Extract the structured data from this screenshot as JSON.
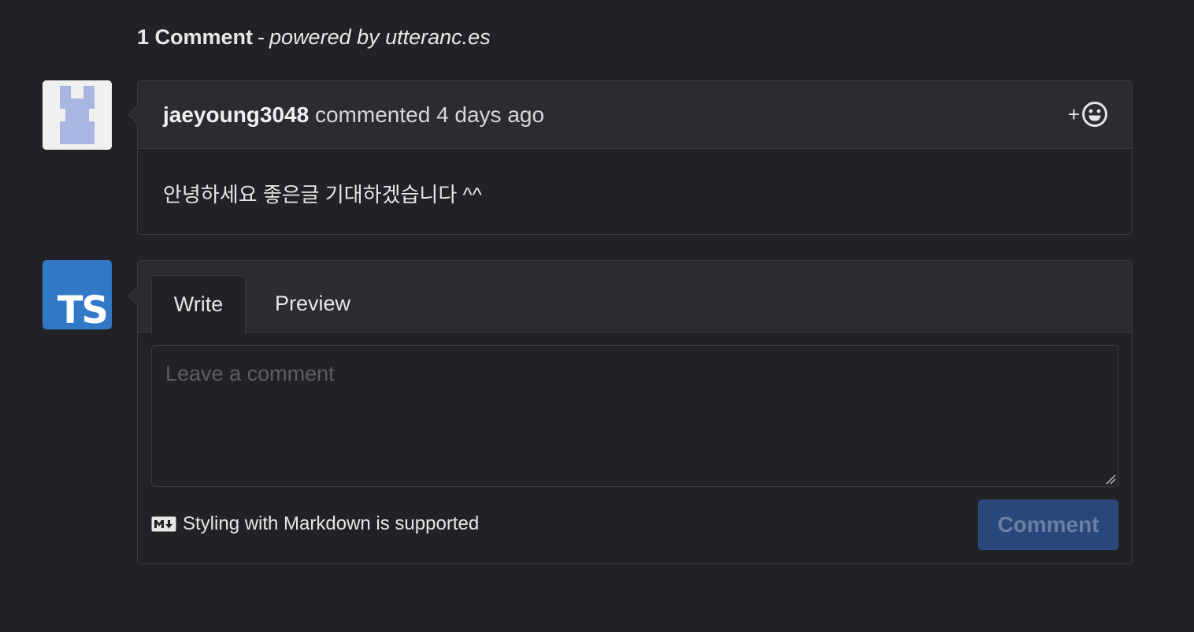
{
  "header": {
    "count_label": "1 Comment",
    "separator": "-",
    "powered_by": "powered by utteranc.es"
  },
  "comments": [
    {
      "author": "jaeyoung3048",
      "action": "commented",
      "time": "4 days ago",
      "body": "안녕하세요 좋은글 기대하겠습니다 ^^",
      "reaction_icon": "smiley-icon",
      "reaction_plus": "+"
    }
  ],
  "new_comment": {
    "avatar_text": "TS",
    "tabs": [
      "Write",
      "Preview"
    ],
    "active_tab": "Write",
    "placeholder": "Leave a comment",
    "value": "",
    "markdown_note": "Styling with Markdown is supported",
    "submit_label": "Comment"
  },
  "colors": {
    "background": "#222226",
    "header_bg": "#2b2b31",
    "border": "#3a3a40",
    "button_bg": "#28477a",
    "ts_blue": "#3178c6",
    "identicon": "#a9b6e1"
  }
}
